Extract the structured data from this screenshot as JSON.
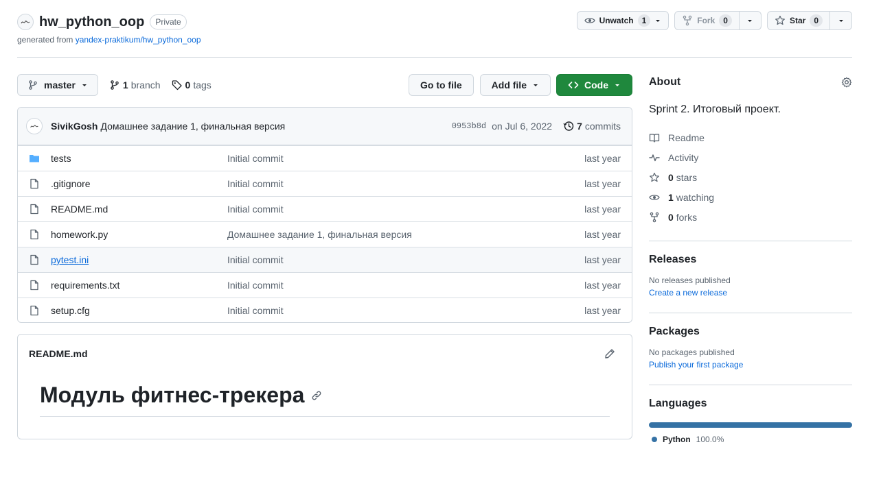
{
  "repo": {
    "name": "hw_python_oop",
    "visibility": "Private",
    "generated_prefix": "generated from",
    "generated_from": "yandex-praktikum/hw_python_oop"
  },
  "actions": {
    "unwatch_label": "Unwatch",
    "unwatch_count": "1",
    "fork_label": "Fork",
    "fork_count": "0",
    "star_label": "Star",
    "star_count": "0"
  },
  "toolbar": {
    "branch": "master",
    "branch_count": "1",
    "branch_word": "branch",
    "tag_count": "0",
    "tag_word": "tags",
    "go_to_file": "Go to file",
    "add_file": "Add file",
    "code": "Code"
  },
  "latest_commit": {
    "author": "SivikGosh",
    "message": "Домашнее задание 1, финальная версия",
    "sha": "0953b8d",
    "date": "on Jul 6, 2022",
    "commit_count": "7",
    "commit_word": "commits"
  },
  "files": [
    {
      "name": "tests",
      "type": "folder",
      "commit": "Initial commit",
      "age": "last year"
    },
    {
      "name": ".gitignore",
      "type": "file",
      "commit": "Initial commit",
      "age": "last year"
    },
    {
      "name": "README.md",
      "type": "file",
      "commit": "Initial commit",
      "age": "last year"
    },
    {
      "name": "homework.py",
      "type": "file",
      "commit": "Домашнее задание 1, финальная версия",
      "age": "last year"
    },
    {
      "name": "pytest.ini",
      "type": "file",
      "commit": "Initial commit",
      "age": "last year"
    },
    {
      "name": "requirements.txt",
      "type": "file",
      "commit": "Initial commit",
      "age": "last year"
    },
    {
      "name": "setup.cfg",
      "type": "file",
      "commit": "Initial commit",
      "age": "last year"
    }
  ],
  "readme": {
    "filename": "README.md",
    "heading": "Модуль фитнес-трекера"
  },
  "about": {
    "title": "About",
    "description": "Sprint 2. Итоговый проект.",
    "readme": "Readme",
    "activity": "Activity",
    "stars_count": "0",
    "stars_word": "stars",
    "watching_count": "1",
    "watching_word": "watching",
    "forks_count": "0",
    "forks_word": "forks"
  },
  "releases": {
    "title": "Releases",
    "empty": "No releases published",
    "link": "Create a new release"
  },
  "packages": {
    "title": "Packages",
    "empty": "No packages published",
    "link": "Publish your first package"
  },
  "languages": {
    "title": "Languages",
    "items": [
      {
        "name": "Python",
        "percent": "100.0%",
        "color": "#3572A5",
        "share": 1.0
      }
    ]
  },
  "colors": {
    "accent_link": "#0969da",
    "code_button": "#1f883d",
    "folder_icon": "#54aeff"
  }
}
